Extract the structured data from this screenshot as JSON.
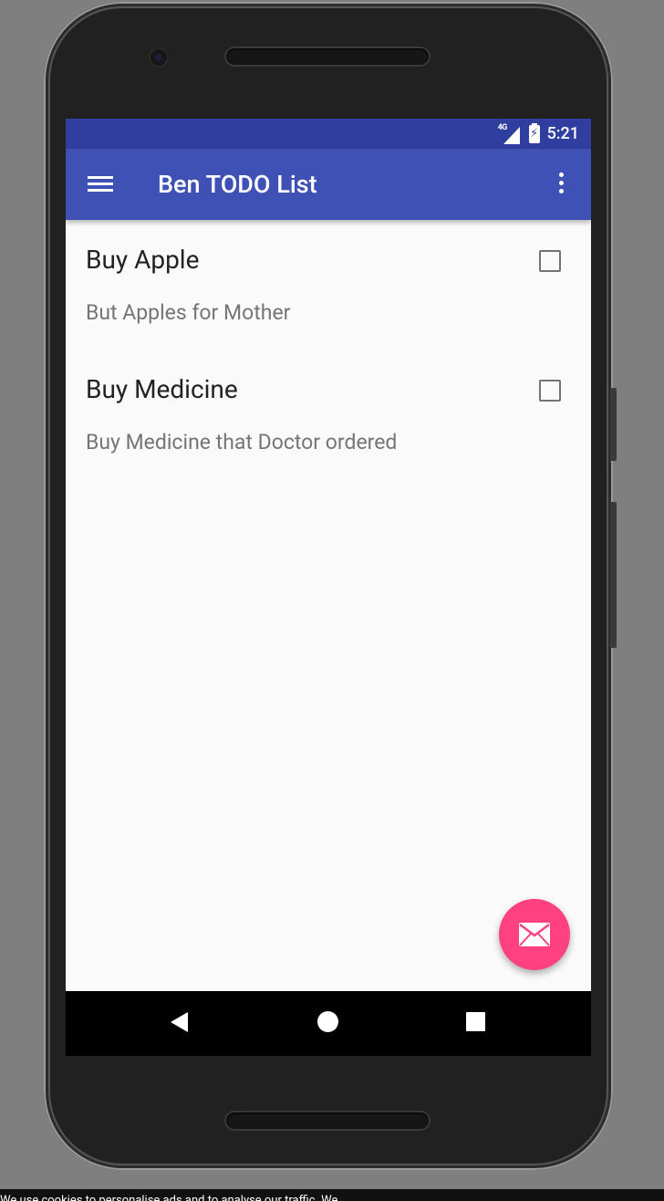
{
  "status_bar": {
    "network_label": "4G",
    "time": "5:21"
  },
  "app_bar": {
    "title": "Ben TODO List"
  },
  "todos": [
    {
      "title": "Buy Apple",
      "description": "But Apples for Mother",
      "checked": false
    },
    {
      "title": "Buy Medicine",
      "description": "Buy Medicine that Doctor ordered",
      "checked": false
    }
  ],
  "fab": {
    "icon": "email-icon",
    "color": "#ff4081"
  },
  "nav_bar": {
    "icons": [
      "back-icon",
      "home-icon",
      "recents-icon"
    ]
  },
  "footer_text": "We use cookies to personalise ads and to analyse our traffic. We",
  "colors": {
    "primary": "#3f51b5",
    "primary_dark": "#303f9f",
    "accent": "#ff4081"
  }
}
